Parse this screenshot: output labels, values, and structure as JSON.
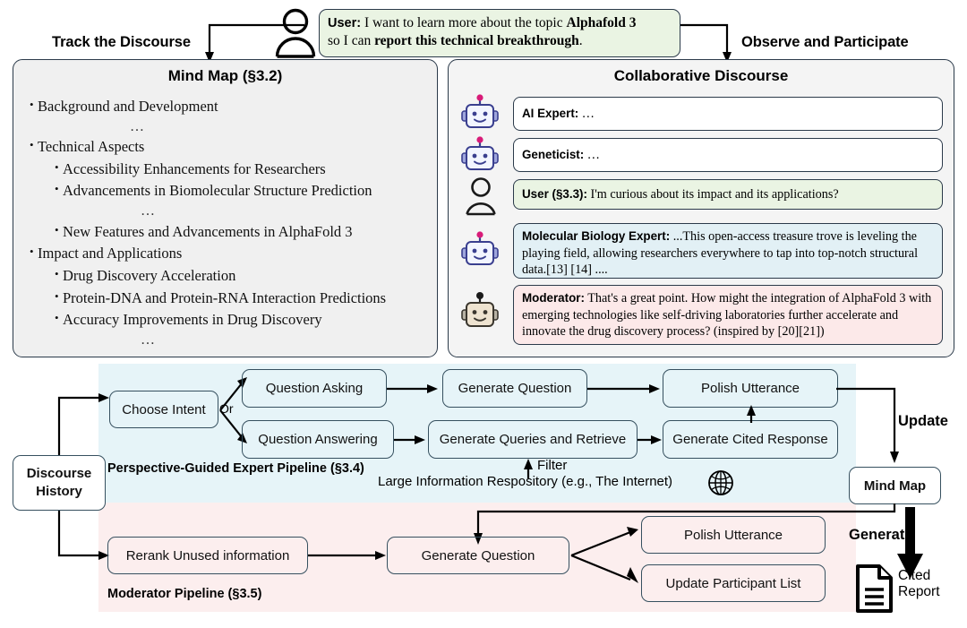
{
  "top": {
    "left_label": "Track the Discourse",
    "right_label": "Observe and Participate",
    "user_icon": "user-avatar-icon",
    "user_message": {
      "speaker": "User:",
      "line1_a": " I want to learn more about the topic ",
      "line1_b": "Alphafold 3",
      "line2_a": "so I can ",
      "line2_b": "report this technical breakthrough",
      "line2_c": "."
    }
  },
  "mind_map_panel": {
    "title": "Mind Map (§3.2)",
    "items": [
      {
        "level": 0,
        "text": "Background and Development"
      },
      {
        "level": "dots",
        "text": "…"
      },
      {
        "level": 0,
        "text": "Technical Aspects"
      },
      {
        "level": 1,
        "text": "Accessibility Enhancements for Researchers"
      },
      {
        "level": 1,
        "text": "Advancements in Biomolecular Structure Prediction"
      },
      {
        "level": "dots",
        "text": "…"
      },
      {
        "level": 1,
        "text": "New Features and Advancements in AlphaFold 3"
      },
      {
        "level": 0,
        "text": "Impact and Applications"
      },
      {
        "level": 1,
        "text": "Drug Discovery Acceleration"
      },
      {
        "level": 1,
        "text": "Protein-DNA and Protein-RNA Interaction Predictions"
      },
      {
        "level": 1,
        "text": "Accuracy Improvements in Drug Discovery"
      },
      {
        "level": "dots",
        "text": "…"
      }
    ]
  },
  "discourse_panel": {
    "title": "Collaborative Discourse",
    "messages": [
      {
        "avatar": "robot-blue-icon",
        "speaker": "AI Expert:",
        "body": " …",
        "style": "white"
      },
      {
        "avatar": "robot-blue-icon",
        "speaker": "Geneticist:",
        "body": " …",
        "style": "white"
      },
      {
        "avatar": "user-avatar-icon",
        "speaker": "User (§3.3):",
        "body": " I'm curious about its impact and its applications?",
        "style": "green"
      },
      {
        "avatar": "robot-blue-icon",
        "speaker": "Molecular Biology Expert:",
        "body": " ...This open-access treasure trove is leveling the playing field, allowing researchers everywhere to tap into top-notch structural data.[13] [14] ....",
        "style": "blue"
      },
      {
        "avatar": "robot-tan-icon",
        "speaker": "Moderator:",
        "body": " That's a great point. How might the integration of AlphaFold 3 with emerging technologies like self-driving laboratories further accelerate and innovate the drug discovery process? (inspired by [20][21])",
        "style": "pink"
      }
    ]
  },
  "pipeline": {
    "discourse_history": "Discourse\nHistory",
    "discourse_history_line1": "Discourse",
    "discourse_history_line2": "History",
    "expert": {
      "region_title": "Perspective-Guided Expert Pipeline (§3.4)",
      "choose_intent": "Choose Intent",
      "or_label": "Or",
      "question_asking": "Question Asking",
      "question_answering": "Question Answering",
      "generate_question": "Generate Question",
      "generate_queries": "Generate Queries and Retrieve",
      "generate_cited_response": "Generate Cited Response",
      "polish_utterance": "Polish Utterance",
      "filter_label": "Filter",
      "repository_label": "Large Information Respository (e.g., The Internet)",
      "globe_icon": "globe-icon"
    },
    "moderator": {
      "region_title": "Moderator Pipeline (§3.5)",
      "rerank": "Rerank Unused information",
      "generate_question": "Generate Question",
      "polish_utterance": "Polish Utterance",
      "update_participant_list": "Update Participant List"
    },
    "mind_map_node": "Mind Map",
    "update_label": "Update",
    "generate_label": "Generate",
    "cited_report_line1": "Cited",
    "cited_report_line2": "Report",
    "report_icon": "document-icon"
  },
  "colors": {
    "border": "#2b3a4a",
    "node_border": "#36505f",
    "blue_region": "#e6f4f8",
    "pink_region": "#fceeee",
    "green_bubble": "#eaf4e3",
    "blue_bubble": "#e2f0f5",
    "pink_bubble": "#fce9e9",
    "mind_map_bg": "#f0f0f0",
    "discourse_bg": "#f4f4f4",
    "robot_blue": "#3a3f8f",
    "robot_tan": "#e8ddc8",
    "antenna_pink": "#d81b78"
  }
}
